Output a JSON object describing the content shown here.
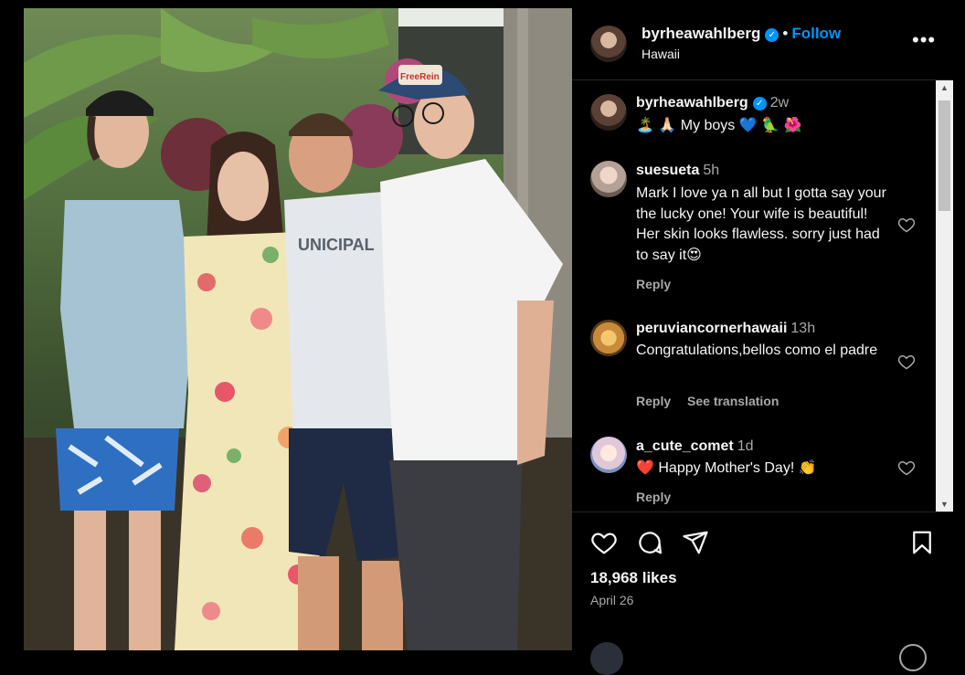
{
  "post": {
    "username": "byrheawahlberg",
    "follow_label": "Follow",
    "location": "Hawaii",
    "more_label": "•••"
  },
  "caption": {
    "username": "byrheawahlberg",
    "time": "2w",
    "text": "🏝️ 🙏🏻 My boys 💙 🦜 🌺"
  },
  "comments": [
    {
      "username": "suesueta",
      "time": "5h",
      "text": "Mark I love ya n all but I gotta say your the lucky one! Your wife is beautiful! Her skin looks flawless. sorry just had to say it😍",
      "reply_label": "Reply"
    },
    {
      "username": "peruviancornerhawaii",
      "time": "13h",
      "text": "Congratulations,bellos como el padre",
      "reply_label": "Reply",
      "translate_label": "See translation"
    },
    {
      "username": "a_cute_comet",
      "time": "1d",
      "text": "❤️ Happy Mother's Day! 👏",
      "reply_label": "Reply"
    }
  ],
  "engagement": {
    "likes": "18,968 likes",
    "date": "April 26"
  },
  "icons": [
    "like-icon",
    "comment-icon",
    "share-icon",
    "save-icon",
    "verified-icon",
    "heart-icon",
    "more-options-icon"
  ],
  "colors": {
    "accent": "#0095f6",
    "background": "#000000",
    "secondary_text": "#a8a8a8"
  }
}
